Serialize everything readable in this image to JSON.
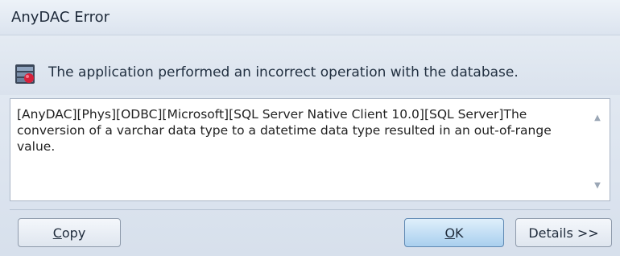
{
  "window": {
    "title": "AnyDAC Error"
  },
  "message": {
    "icon": "database-error-icon",
    "text": "The application performed an incorrect operation with the database."
  },
  "error_details": {
    "text": "[AnyDAC][Phys][ODBC][Microsoft][SQL Server Native Client 10.0][SQL Server]The conversion of a varchar data type to a datetime data type resulted in an out-of-range value."
  },
  "buttons": {
    "copy_first": "C",
    "copy_rest": "opy",
    "ok_first": "O",
    "ok_rest": "K",
    "details": "Details >>"
  },
  "colors": {
    "background": "#dde5ef",
    "ok_button": "#a9cfee",
    "icon_accent": "#d6203a"
  }
}
